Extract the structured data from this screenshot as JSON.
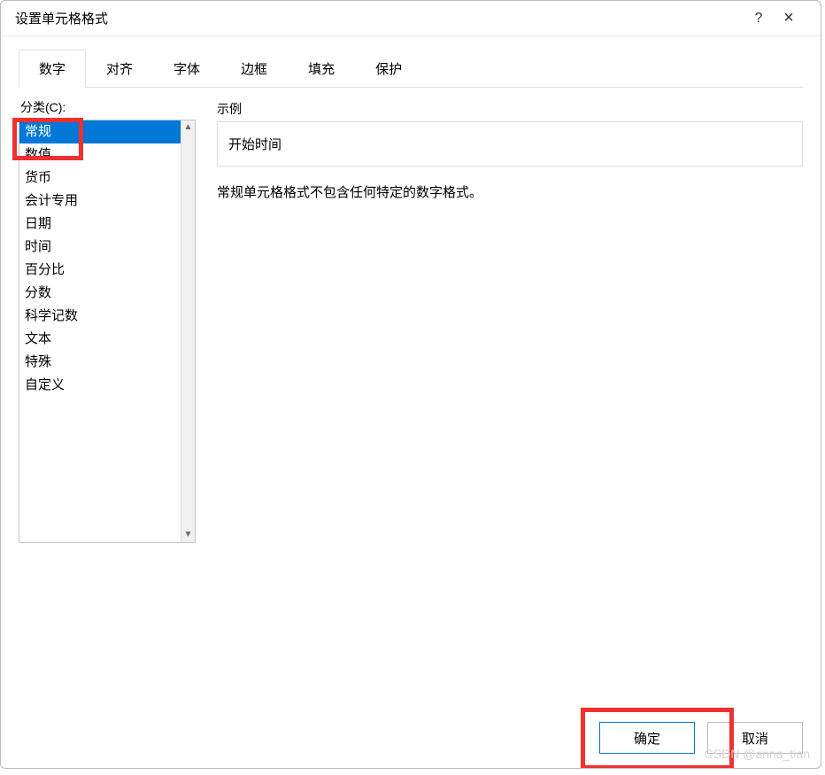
{
  "title": "设置单元格格式",
  "titlebar": {
    "help_tooltip": "?",
    "close_tooltip": "×"
  },
  "tabs": [
    {
      "id": "number",
      "label": "数字",
      "active": true
    },
    {
      "id": "align",
      "label": "对齐",
      "active": false
    },
    {
      "id": "font",
      "label": "字体",
      "active": false
    },
    {
      "id": "border",
      "label": "边框",
      "active": false
    },
    {
      "id": "fill",
      "label": "填充",
      "active": false
    },
    {
      "id": "protect",
      "label": "保护",
      "active": false
    }
  ],
  "category": {
    "label": "分类(C):",
    "items": [
      {
        "id": "general",
        "label": "常规",
        "selected": true
      },
      {
        "id": "number",
        "label": "数值",
        "selected": false
      },
      {
        "id": "currency",
        "label": "货币",
        "selected": false
      },
      {
        "id": "accounting",
        "label": "会计专用",
        "selected": false
      },
      {
        "id": "date",
        "label": "日期",
        "selected": false
      },
      {
        "id": "time",
        "label": "时间",
        "selected": false
      },
      {
        "id": "percentage",
        "label": "百分比",
        "selected": false
      },
      {
        "id": "fraction",
        "label": "分数",
        "selected": false
      },
      {
        "id": "scientific",
        "label": "科学记数",
        "selected": false
      },
      {
        "id": "text",
        "label": "文本",
        "selected": false
      },
      {
        "id": "special",
        "label": "特殊",
        "selected": false
      },
      {
        "id": "custom",
        "label": "自定义",
        "selected": false
      }
    ]
  },
  "sample": {
    "label": "示例",
    "value": "开始时间"
  },
  "description": "常规单元格格式不包含任何特定的数字格式。",
  "buttons": {
    "ok_label": "确定",
    "cancel_label": "取消"
  },
  "watermark": "CSDN @anna_tian"
}
